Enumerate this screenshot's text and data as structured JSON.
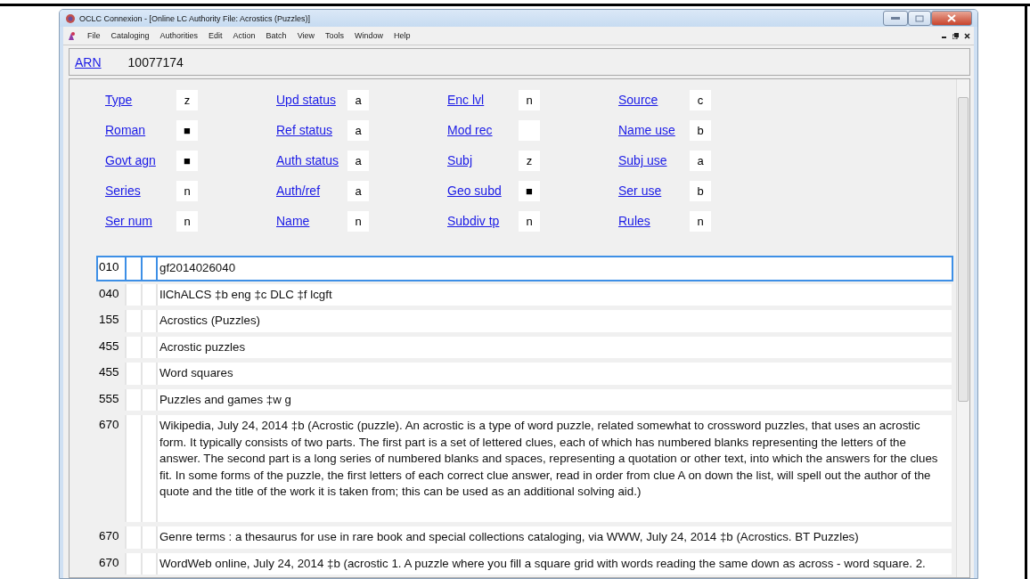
{
  "window": {
    "title": "OCLC Connexion - [Online LC Authority File: Acrostics (Puzzles)]"
  },
  "menu": [
    "File",
    "Cataloging",
    "Authorities",
    "Edit",
    "Action",
    "Batch",
    "View",
    "Tools",
    "Window",
    "Help"
  ],
  "arn": {
    "label": "ARN",
    "value": "10077174"
  },
  "fixed_fields": [
    [
      {
        "label": "Type",
        "value": "z"
      },
      {
        "label": "Upd status",
        "value": "a"
      },
      {
        "label": "Enc lvl",
        "value": "n"
      },
      {
        "label": "Source",
        "value": "c"
      }
    ],
    [
      {
        "label": "Roman",
        "value": "■"
      },
      {
        "label": "Ref status",
        "value": "a"
      },
      {
        "label": "Mod rec"
      },
      {
        "label": "Name use",
        "value": "b"
      }
    ],
    [
      {
        "label": "Govt agn",
        "value": "■"
      },
      {
        "label": "Auth status",
        "value": "a"
      },
      {
        "label": "Subj",
        "value": "z"
      },
      {
        "label": "Subj use",
        "value": "a"
      }
    ],
    [
      {
        "label": "Series",
        "value": "n"
      },
      {
        "label": "Auth/ref",
        "value": "a"
      },
      {
        "label": "Geo subd",
        "value": "■"
      },
      {
        "label": "Ser use",
        "value": "b"
      }
    ],
    [
      {
        "label": "Ser num",
        "value": "n"
      },
      {
        "label": "Name",
        "value": "n"
      },
      {
        "label": "Subdiv tp",
        "value": "n"
      },
      {
        "label": "Rules",
        "value": "n"
      }
    ]
  ],
  "fields": [
    {
      "tag": "010",
      "data": "gf2014026040",
      "selected": true
    },
    {
      "tag": "040",
      "data": "IlChALCS ‡b eng ‡c DLC ‡f lcgft",
      "selected": false
    },
    {
      "tag": "155",
      "data": "Acrostics (Puzzles)",
      "selected": false
    },
    {
      "tag": "455",
      "data": "Acrostic puzzles",
      "selected": false
    },
    {
      "tag": "455",
      "data": "Word squares",
      "selected": false
    },
    {
      "tag": "555",
      "data": "Puzzles and games ‡w g",
      "selected": false
    },
    {
      "tag": "670",
      "data": "Wikipedia, July 24, 2014 ‡b (Acrostic (puzzle). An acrostic is a type of word puzzle, related somewhat to crossword puzzles, that uses an acrostic form. It typically consists of two parts. The first part is a set of lettered clues, each of which has numbered blanks representing the letters of the answer. The second part is a long series of numbered blanks and spaces, representing a quotation or other text, into which the answers for the clues fit. In some forms of the puzzle, the first letters of each correct clue answer, read in order from clue A on down the list, will spell out the author of the quote and the title of the work it is taken from; this can be used as an additional solving aid.)",
      "selected": false
    },
    {
      "tag": "670",
      "data": "Genre terms : a thesaurus for use in rare book and special collections cataloging, via WWW, July 24, 2014 ‡b (Acrostics. BT Puzzles)",
      "selected": false
    },
    {
      "tag": "670",
      "data": "WordWeb online, July 24, 2014 ‡b (acrostic 1. A puzzle where you fill a square grid with words reading the same down as across - word square. 2.",
      "selected": false
    }
  ]
}
